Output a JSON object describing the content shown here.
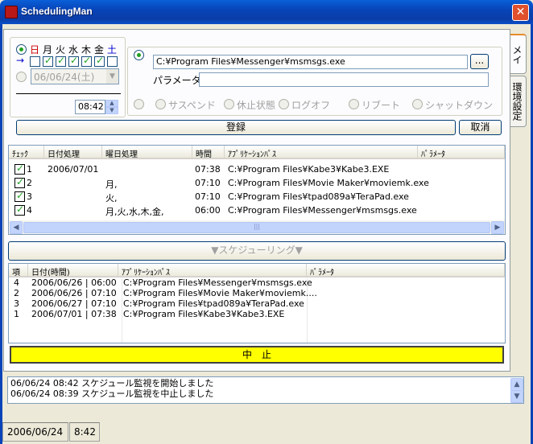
{
  "window": {
    "title": "SchedulingMan",
    "close_label": "✕"
  },
  "tabs": [
    {
      "label": "メイン",
      "active": true
    },
    {
      "label": "環境設定",
      "active": false
    }
  ],
  "weekdays": [
    {
      "label": "日",
      "checked": false,
      "color": "#cc0000"
    },
    {
      "label": "月",
      "checked": true,
      "color": "#000000"
    },
    {
      "label": "火",
      "checked": true,
      "color": "#000000"
    },
    {
      "label": "水",
      "checked": true,
      "color": "#000000"
    },
    {
      "label": "木",
      "checked": true,
      "color": "#000000"
    },
    {
      "label": "金",
      "checked": true,
      "color": "#000000"
    },
    {
      "label": "土",
      "checked": false,
      "color": "#0000cc"
    }
  ],
  "schedule": {
    "arrow": "→",
    "date_value": "06/06/24(土)",
    "time_value": "08:42",
    "app_path": "C:¥Program Files¥Messenger¥msmsgs.exe",
    "browse_label": "...",
    "param_label": "パラメータ",
    "param_value": "",
    "power_options": [
      "サスペンド",
      "休止状態",
      "ログオフ",
      "リブート",
      "シャットダウン"
    ],
    "register_label": "登録",
    "cancel_label": "取消"
  },
  "registered": {
    "columns": [
      "ﾁｪｯｸ",
      "日付処理",
      "曜日処理",
      "時間",
      "ｱﾌﾟﾘｹｰｼｮﾝﾊﾟｽ",
      "ﾊﾟﾗﾒｰﾀ"
    ],
    "rows": [
      {
        "check": "1",
        "date": "2006/07/01",
        "weekday": "",
        "time": "07:38",
        "path": "C:¥Program Files¥Kabe3¥Kabe3.EXE",
        "param": ""
      },
      {
        "check": "2",
        "date": "",
        "weekday": "月,",
        "time": "07:10",
        "path": "C:¥Program Files¥Movie Maker¥moviemk.exe",
        "param": ""
      },
      {
        "check": "3",
        "date": "",
        "weekday": "火,",
        "time": "07:10",
        "path": "C:¥Program Files¥tpad089a¥TeraPad.exe",
        "param": ""
      },
      {
        "check": "4",
        "date": "",
        "weekday": "月,火,水,木,金,",
        "time": "06:00",
        "path": "C:¥Program Files¥Messenger¥msmsgs.exe",
        "param": ""
      }
    ],
    "hscroll_grip": "|||"
  },
  "scheduling": {
    "header_label": "▼スケジューリング▼",
    "columns": [
      "項",
      "日付(時間)",
      "ｱﾌﾟﾘｹｰｼｮﾝﾊﾟｽ",
      "ﾊﾟﾗﾒｰﾀ"
    ],
    "rows": [
      {
        "no": "4",
        "datetime": "2006/06/26 | 06:00",
        "path": "C:¥Program Files¥Messenger¥msmsgs.exe",
        "param": ""
      },
      {
        "no": "2",
        "datetime": "2006/06/26 | 07:10",
        "path": "C:¥Program Files¥Movie Maker¥moviemk....",
        "param": ""
      },
      {
        "no": "3",
        "datetime": "2006/06/27 | 07:10",
        "path": "C:¥Program Files¥tpad089a¥TeraPad.exe",
        "param": ""
      },
      {
        "no": "1",
        "datetime": "2006/07/01 | 07:38",
        "path": "C:¥Program Files¥Kabe3¥Kabe3.EXE",
        "param": ""
      }
    ],
    "stop_label": "中　止"
  },
  "log": [
    "06/06/24 08:42 スケジュール監視を開始しました",
    "06/06/24 08:39 スケジュール監視を中止しました"
  ],
  "status": {
    "date": "2006/06/24",
    "time": "8:42"
  },
  "colors": {
    "titlebar": "#0a50c8",
    "stop_button": "#ffff00",
    "check_green": "#21a121"
  }
}
